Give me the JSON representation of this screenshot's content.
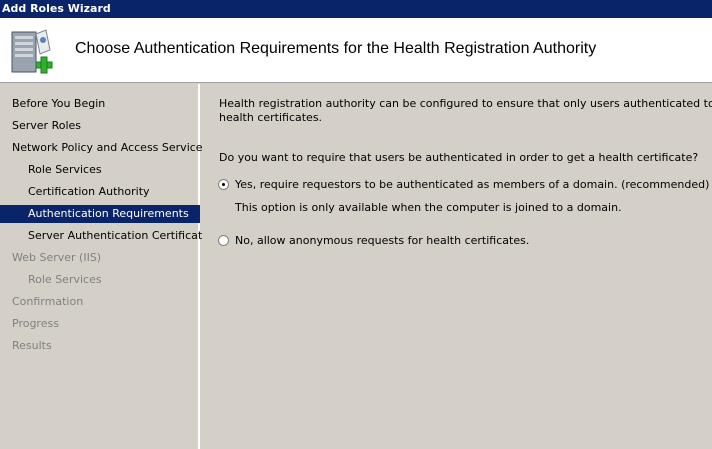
{
  "window": {
    "title": "Add Roles Wizard"
  },
  "header": {
    "icon": "server-add-role-icon",
    "title": "Choose Authentication Requirements for the Health Registration Authority"
  },
  "sidebar": {
    "items": [
      {
        "label": "Before You Begin",
        "state": "normal"
      },
      {
        "label": "Server Roles",
        "state": "normal"
      },
      {
        "label": "Network Policy and Access Services",
        "state": "normal"
      },
      {
        "label": "Role Services",
        "state": "normal"
      },
      {
        "label": "Certification Authority",
        "state": "normal"
      },
      {
        "label": "Authentication Requirements",
        "state": "selected"
      },
      {
        "label": "Server Authentication Certificate",
        "state": "normal"
      },
      {
        "label": "Web Server (IIS)",
        "state": "disabled"
      },
      {
        "label": "Role Services",
        "state": "disabled"
      },
      {
        "label": "Confirmation",
        "state": "disabled"
      },
      {
        "label": "Progress",
        "state": "disabled"
      },
      {
        "label": "Results",
        "state": "disabled"
      }
    ]
  },
  "main": {
    "intro_line1": "Health registration authority can be configured to ensure that only users authenticated to the domain c",
    "intro_line2": "health certificates.",
    "question": "Do you want to require that users be authenticated in order to get a health certificate?",
    "options": [
      {
        "label": "Yes, require requestors to be authenticated as members of a domain. (recommended)",
        "checked": true,
        "note": "This option is only available when the computer is joined to a domain."
      },
      {
        "label": "No, allow anonymous requests for health certificates.",
        "checked": false
      }
    ]
  },
  "colors": {
    "titlebar": "#0a246a",
    "selection": "#0a246a",
    "panel": "#d4d0c8",
    "disabled_text": "#808080",
    "plus_green": "#2fb02f"
  }
}
